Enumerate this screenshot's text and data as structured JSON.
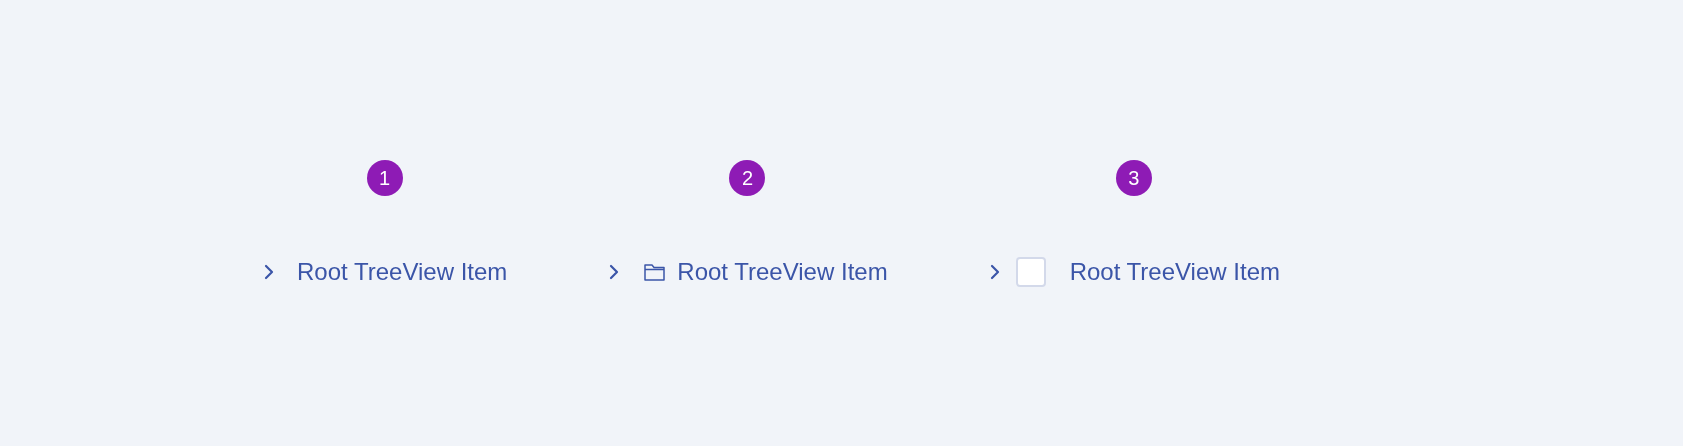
{
  "examples": [
    {
      "badge": "1",
      "kind": "plain",
      "label": "Root TreeView Item"
    },
    {
      "badge": "2",
      "kind": "folder",
      "label": "Root TreeView Item"
    },
    {
      "badge": "3",
      "kind": "checkbox",
      "checked": false,
      "label": "Root TreeView Item"
    }
  ]
}
